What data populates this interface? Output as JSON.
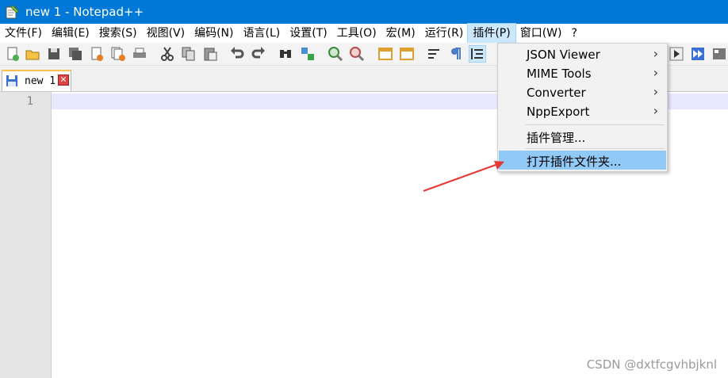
{
  "window": {
    "title": "new 1 - Notepad++"
  },
  "menubar": {
    "items": [
      "文件(F)",
      "编辑(E)",
      "搜索(S)",
      "视图(V)",
      "编码(N)",
      "语言(L)",
      "设置(T)",
      "工具(O)",
      "宏(M)",
      "运行(R)",
      "插件(P)",
      "窗口(W)",
      "?"
    ],
    "active": "插件(P)"
  },
  "tabs": [
    {
      "title": "new 1",
      "close": "✕"
    }
  ],
  "editor": {
    "line_numbers": [
      "1"
    ]
  },
  "plugins_menu": {
    "items": [
      {
        "label": "JSON Viewer",
        "submenu_arrow": "›"
      },
      {
        "label": "MIME Tools",
        "submenu_arrow": "›"
      },
      {
        "label": "Converter",
        "submenu_arrow": "›"
      },
      {
        "label": "NppExport",
        "submenu_arrow": "›"
      },
      {
        "label": "插件管理..."
      },
      {
        "label": "打开插件文件夹...",
        "highlighted": true
      }
    ]
  },
  "watermark": "CSDN @dxtfcgvhbjknl",
  "colors": {
    "titlebar": "#0078d7",
    "highlight": "#91c9f7",
    "arrow": "#e53935"
  }
}
